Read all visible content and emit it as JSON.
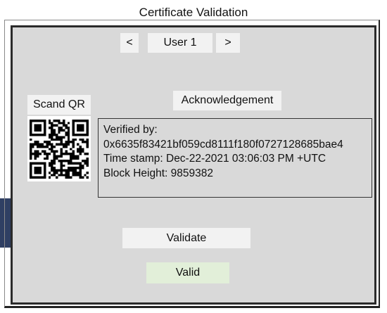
{
  "window": {
    "title": "Certificate Validation"
  },
  "nav": {
    "prev_label": "<",
    "user_label": "User 1",
    "next_label": ">"
  },
  "qr": {
    "button_label": "Scand QR",
    "icon": "qr-code-icon"
  },
  "acknowledgement": {
    "button_label": "Acknowledgement",
    "verified_by_label": "Verified by:",
    "verified_by_value": "0x6635f83421bf059cd8111f180f0727128685bae4",
    "timestamp": "Time stamp: Dec-22-2021 03:06:03 PM +UTC",
    "block_height": "Block Height: 9859382"
  },
  "actions": {
    "validate_label": "Validate",
    "status_label": "Valid"
  },
  "colors": {
    "panel": "#d9d9d9",
    "button": "#f2f2f2",
    "valid_bg": "#e2efd9",
    "side_strip": "#2f3f63"
  }
}
